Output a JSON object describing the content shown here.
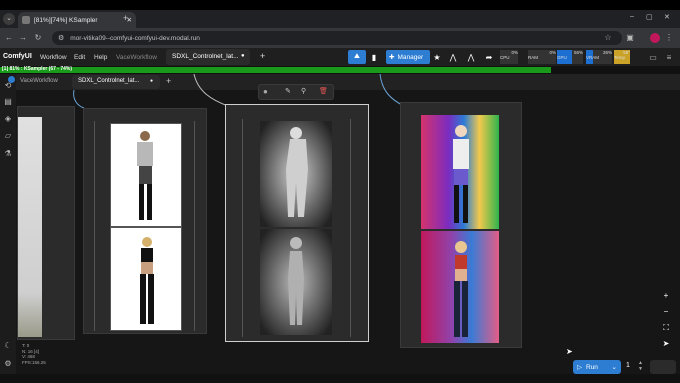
{
  "browser": {
    "tab_title": "[81%][74%] KSampler",
    "new_tab": "+",
    "url": "mor-vitika09--comfyui-comfyui-dev.modal.run",
    "window_min": "–",
    "window_max": "▢",
    "window_close": "✕"
  },
  "app": {
    "logo": "ComfyUI",
    "menu": [
      "Workflow",
      "Edit",
      "Help"
    ],
    "tabs": [
      "VaceWorkflow",
      "SDXL_Controlnet_lat..."
    ],
    "add_tab": "+",
    "manager_label": "Manager",
    "monitors": [
      {
        "label": "CPU",
        "value": "0%"
      },
      {
        "label": "RAM",
        "value": "0%"
      },
      {
        "label": "GPU",
        "value": "56%"
      },
      {
        "label": "VRAM",
        "value": "26%"
      },
      {
        "label": "Temp",
        "value": "59°"
      }
    ]
  },
  "progress": {
    "text": "[1] 81% : KSampler (67 - 74%)",
    "percent": 81
  },
  "workspace_tabs": [
    "VaceWorkflow",
    "SDXL_Controlnet_lat..."
  ],
  "info": {
    "line1": "T: 0",
    "line2": "N: 16 [4]",
    "line3": "V: 468",
    "line4": "FPS:156.25"
  },
  "run": {
    "label": "Run",
    "batch_count": "1"
  },
  "colors": {
    "progress": "#1a9a1a",
    "accent": "#2d7dd2",
    "gpu": "#1d6fd1",
    "temp": "#c9a227"
  }
}
